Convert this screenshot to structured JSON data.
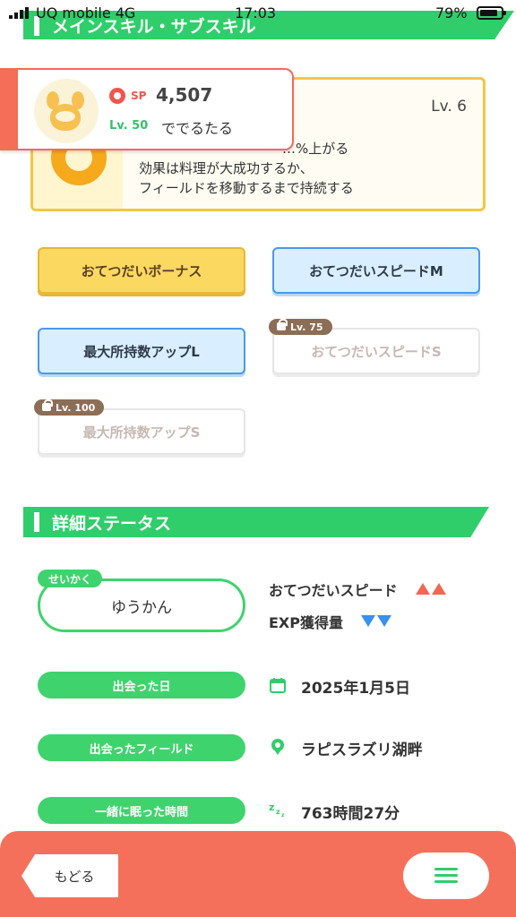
{
  "status_bar": {
    "carrier": "UQ mobile  4G",
    "time": "17:03",
    "battery": "79%"
  },
  "sections": {
    "skills_title": "メインスキル・サブスキル",
    "detail_title": "詳細ステータス"
  },
  "pokemon": {
    "sp_label": "SP",
    "sp_value": "4,507",
    "level": "Lv. 50",
    "name": "ででるたる"
  },
  "main_skill": {
    "level": "Lv. 6",
    "description_line1": "…%上がる",
    "description_line2": "効果は料理が大成功するか、",
    "description_line3": "フィールドを移動するまで持続する"
  },
  "subskills": [
    {
      "label": "おてつだいボーナス"
    },
    {
      "label": "おてつだいスピードM"
    },
    {
      "label": "最大所持数アップL"
    },
    {
      "label": "おてつだいスピードS",
      "unlock_level": "Lv. 75"
    },
    {
      "label": "最大所持数アップS",
      "unlock_level": "Lv. 100"
    }
  ],
  "nature": {
    "tag": "せいかく",
    "value": "ゆうかん",
    "up_effect": "おてつだいスピード",
    "down_effect": "EXP獲得量"
  },
  "details": [
    {
      "label": "出会った日",
      "value": "2025年1月5日",
      "icon": "calendar-icon"
    },
    {
      "label": "出会ったフィールド",
      "value": "ラピスラズリ湖畔",
      "icon": "location-pin-icon"
    },
    {
      "label": "一緒に眠った時間",
      "value": "763時間27分",
      "icon": "sleep-zzz-icon"
    }
  ],
  "bottom": {
    "back_label": "もどる",
    "menu_icon": "hamburger-menu-icon"
  },
  "colors": {
    "green": "#2fce6a",
    "coral": "#f5705a",
    "gold": "#fbd860",
    "blue": "#d9efff",
    "up": "#f4664f",
    "down": "#3a8ff0"
  }
}
